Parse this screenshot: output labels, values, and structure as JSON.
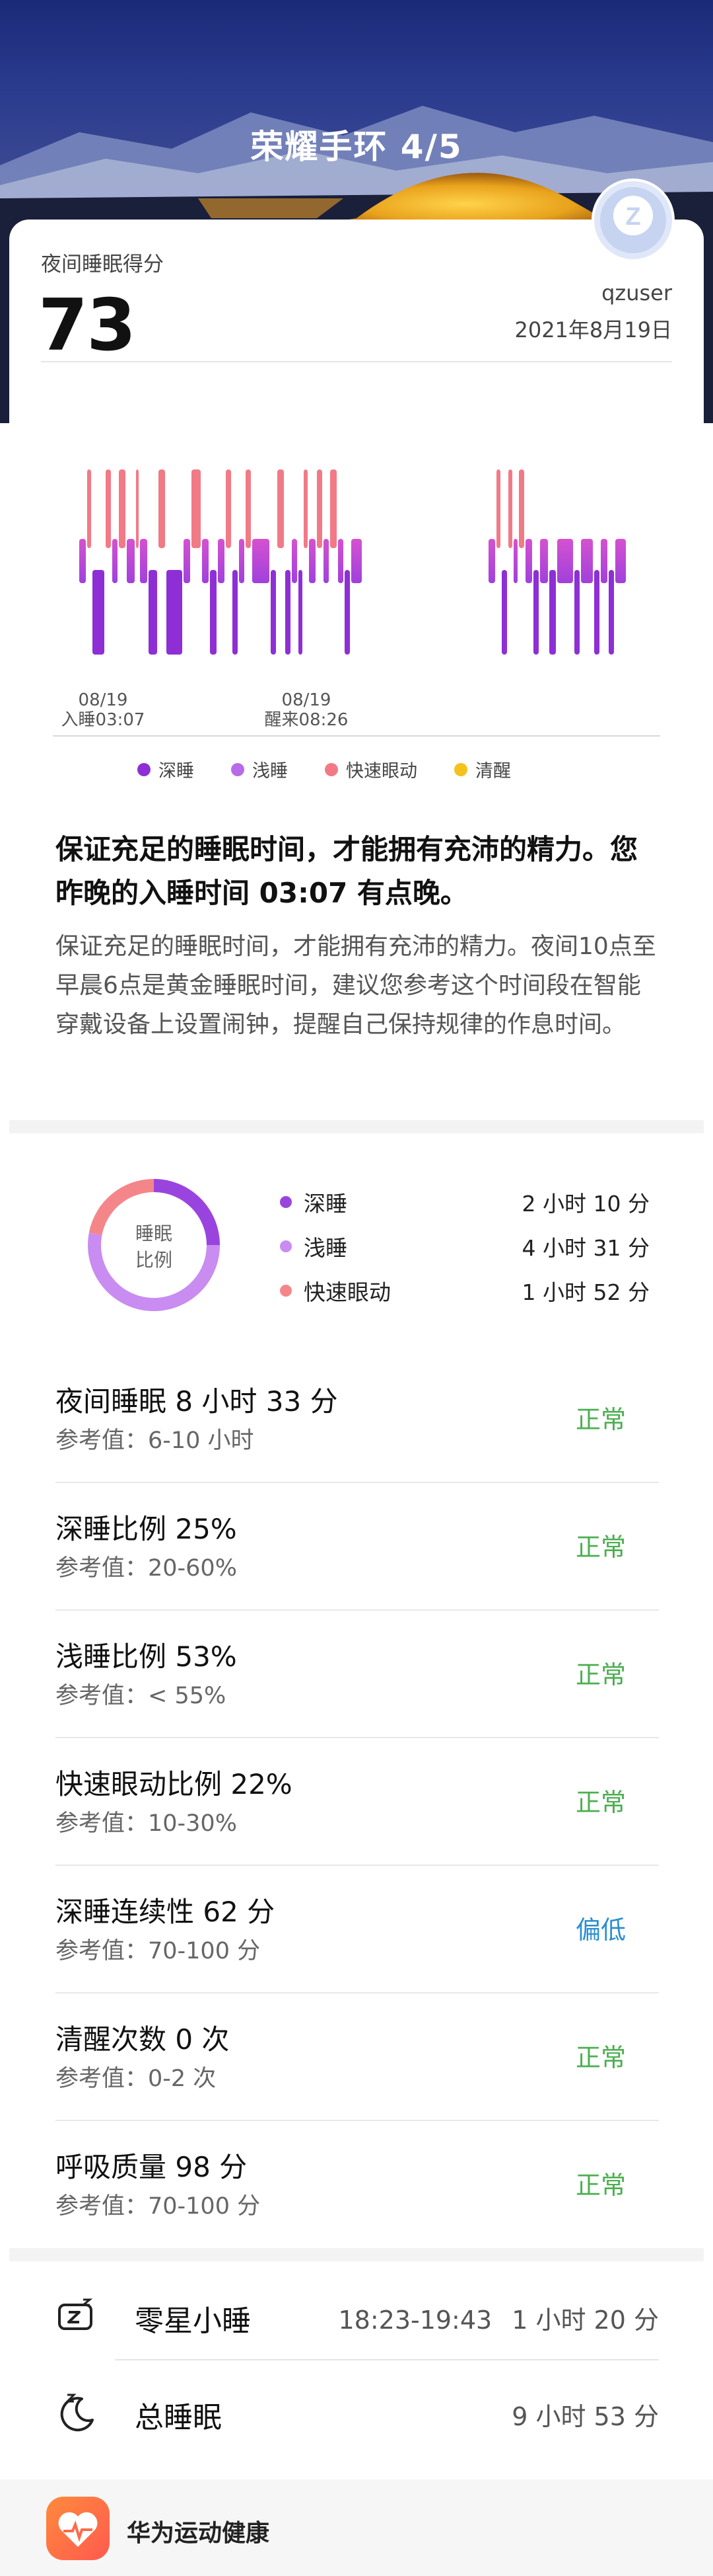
{
  "header": {
    "title": "荣耀手环 4/5"
  },
  "score": {
    "label": "夜间睡眠得分",
    "value": "73",
    "user": "qzuser",
    "date": "2021年8月19日"
  },
  "chart_data": {
    "type": "bar",
    "x_labels": [
      {
        "date": "08/19",
        "label": "入睡03:07"
      },
      {
        "date": "08/19",
        "label": "醒来08:26"
      }
    ],
    "legend": [
      {
        "name": "深睡",
        "color": "#8e2fd6"
      },
      {
        "name": "浅睡",
        "color": "#b86be8"
      },
      {
        "name": "快速眼动",
        "color": "#f17a86"
      },
      {
        "name": "清醒",
        "color": "#f5c21b"
      }
    ]
  },
  "advice": {
    "title": "保证充足的睡眠时间，才能拥有充沛的精力。您昨晚的入睡时间 03:07 有点晚。",
    "body": "保证充足的睡眠时间，才能拥有充沛的精力。夜间10点至早晨6点是黄金睡眠时间，建议您参考这个时间段在智能穿戴设备上设置闹钟，提醒自己保持规律的作息时间。"
  },
  "ratio": {
    "center_line1": "睡眠",
    "center_line2": "比例",
    "items": [
      {
        "name": "深睡",
        "value": "2 小时 10 分",
        "color": "#9a44e0",
        "fraction": 0.25
      },
      {
        "name": "浅睡",
        "value": "4 小时 31 分",
        "color": "#c98cf0",
        "fraction": 0.53
      },
      {
        "name": "快速眼动",
        "value": "1 小时 52 分",
        "color": "#f4868a",
        "fraction": 0.22
      }
    ]
  },
  "metrics": [
    {
      "name": "夜间睡眠  8 小时 33 分",
      "ref": "参考值：6-10 小时",
      "status": "正常"
    },
    {
      "name": "深睡比例  25%",
      "ref": "参考值：20-60%",
      "status": "正常"
    },
    {
      "name": "浅睡比例  53%",
      "ref": "参考值：< 55%",
      "status": "正常"
    },
    {
      "name": "快速眼动比例  22%",
      "ref": "参考值：10-30%",
      "status": "正常"
    },
    {
      "name": "深睡连续性  62 分",
      "ref": "参考值：70-100 分",
      "status": "偏低"
    },
    {
      "name": "清醒次数  0 次",
      "ref": "参考值：0-2 次",
      "status": "正常"
    },
    {
      "name": "呼吸质量  98 分",
      "ref": "参考值：70-100 分",
      "status": "正常"
    }
  ],
  "nap": {
    "label": "零星小睡",
    "time": "18:23-19:43",
    "duration": "1 小时 20 分"
  },
  "total": {
    "label": "总睡眠",
    "duration": "9 小时 53 分"
  },
  "footer": {
    "app_name": "华为运动健康"
  }
}
